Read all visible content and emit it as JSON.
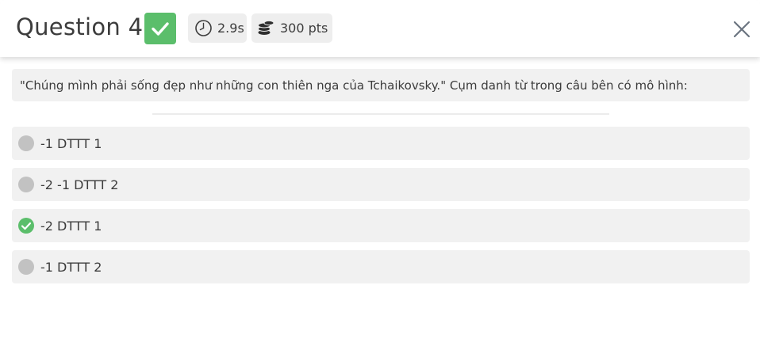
{
  "header": {
    "title": "Question 4",
    "status_icon": "check-icon",
    "time": {
      "icon": "clock-icon",
      "value": "2.9s"
    },
    "points": {
      "icon": "coins-icon",
      "value": "300 pts"
    },
    "close_icon": "close-icon"
  },
  "question": {
    "text": "\"Chúng mình phải sống đẹp như những con thiên nga của Tchaikovsky.\" Cụm danh từ trong câu bên có mô hình:"
  },
  "options": [
    {
      "label": "-1 DTTT 1",
      "state": "unselected"
    },
    {
      "label": "-2 -1 DTTT 2",
      "state": "unselected"
    },
    {
      "label": "-2 DTTT 1",
      "state": "correct"
    },
    {
      "label": "-1 DTTT 2",
      "state": "unselected"
    }
  ],
  "colors": {
    "correct": "#5bbe6b",
    "option_bg": "#f1f1f1",
    "marker_neutral": "#c2c2c2"
  }
}
